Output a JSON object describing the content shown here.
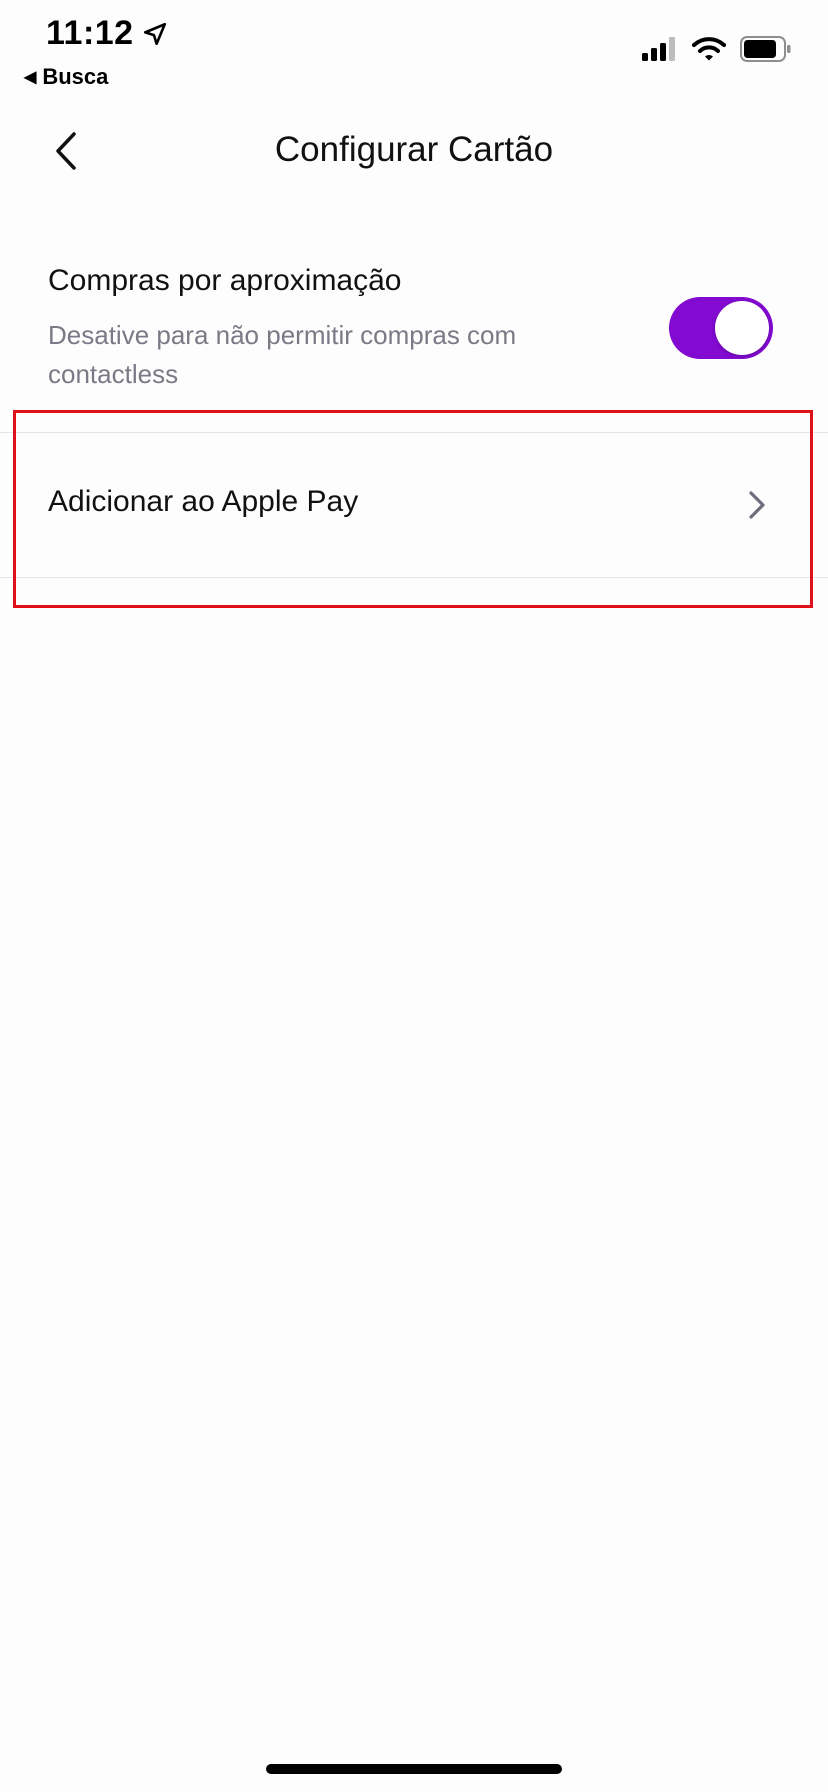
{
  "status_bar": {
    "time": "11:12",
    "back_app_label": "Busca",
    "icons": [
      "location-arrow-icon",
      "cellular-signal-icon",
      "wifi-icon",
      "battery-icon"
    ]
  },
  "nav": {
    "title": "Configurar Cartão",
    "back_icon": "chevron-left-icon"
  },
  "contactless": {
    "title": "Compras por aproximação",
    "description": "Desative para não permitir compras com contactless",
    "toggle_on": true
  },
  "apple_pay": {
    "label": "Adicionar ao Apple Pay",
    "icon": "chevron-right-icon"
  },
  "colors": {
    "accent": "#820ad1",
    "background": "#fdfdfd",
    "text_primary": "#111111",
    "text_secondary": "#7a7a87",
    "highlight": "#e0101a"
  }
}
